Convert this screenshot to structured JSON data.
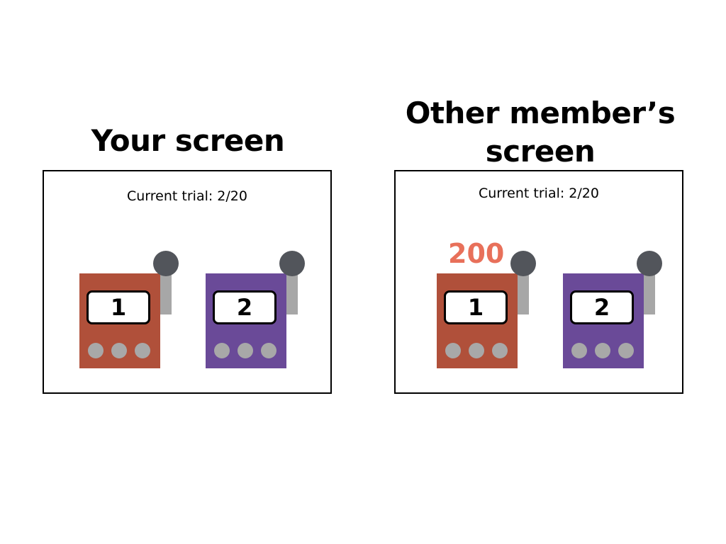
{
  "colors": {
    "machine_1": "#b0503a",
    "machine_2": "#6a4a98",
    "payoff": "#e8705a"
  },
  "left": {
    "heading": "Your screen",
    "trial": "Current trial: 2/20",
    "machines": [
      {
        "number": "1"
      },
      {
        "number": "2"
      }
    ]
  },
  "right": {
    "heading": "Other member’s screen",
    "trial": "Current trial: 2/20",
    "payoff": "200",
    "machines": [
      {
        "number": "1"
      },
      {
        "number": "2"
      }
    ]
  }
}
